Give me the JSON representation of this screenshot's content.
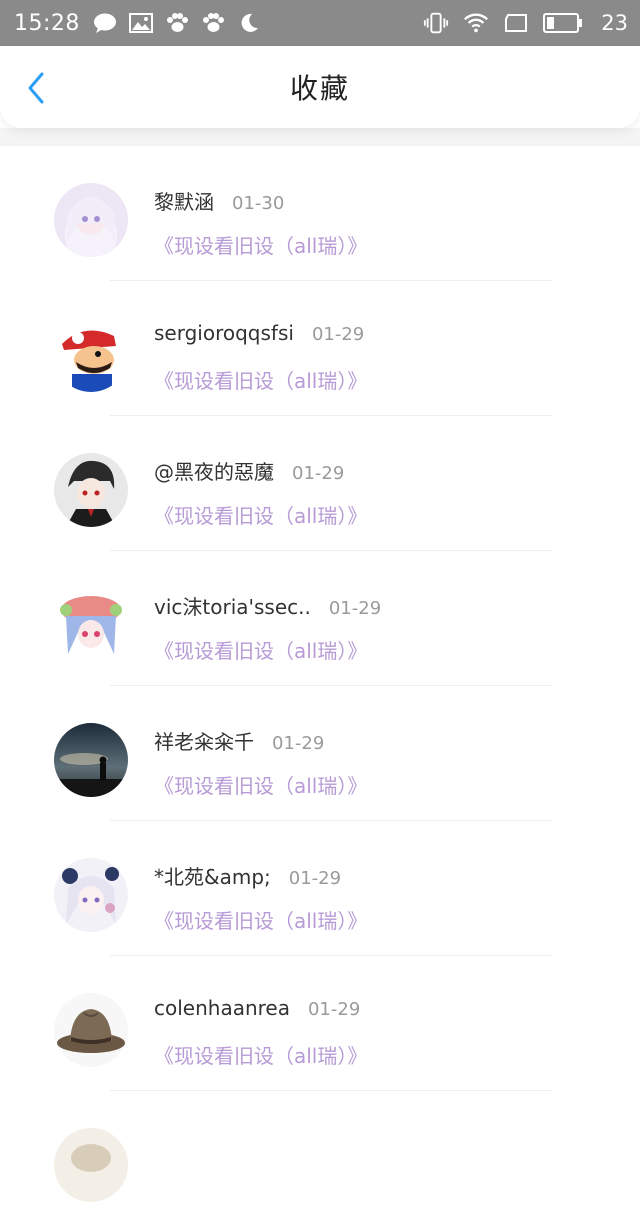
{
  "status_bar": {
    "time": "15:28",
    "battery_level": "23",
    "icons_left": [
      "chat-bubble-icon",
      "image-icon",
      "paw-icon",
      "paw-icon",
      "moon-icon"
    ],
    "icons_right": [
      "vibrate-icon",
      "wifi-icon",
      "screen-rotate-icon",
      "battery-icon"
    ]
  },
  "header": {
    "title": "收藏",
    "back_icon": "chevron-left-icon",
    "accent": "#2a9df4"
  },
  "colors": {
    "title_link": "#b79bd6",
    "date": "#9a9a9a",
    "name": "#333333"
  },
  "favorites": [
    {
      "name": "黎默涵",
      "date": "01-30",
      "title": "《现设看旧设（all瑞）》"
    },
    {
      "name": "sergioroqqsfsi",
      "date": "01-29",
      "title": "《现设看旧设（all瑞）》"
    },
    {
      "name": "@黑夜的惡魔",
      "date": "01-29",
      "title": "《现设看旧设（all瑞）》"
    },
    {
      "name": "vic沫toria'ssec..",
      "date": "01-29",
      "title": "《现设看旧设（all瑞）》"
    },
    {
      "name": "祥老籴籴千",
      "date": "01-29",
      "title": "《现设看旧设（all瑞）》"
    },
    {
      "name": "*北苑&amp;",
      "date": "01-29",
      "title": "《现设看旧设（all瑞）》"
    },
    {
      "name": "colenhaanrea",
      "date": "01-29",
      "title": "《现设看旧设（all瑞）》"
    }
  ]
}
